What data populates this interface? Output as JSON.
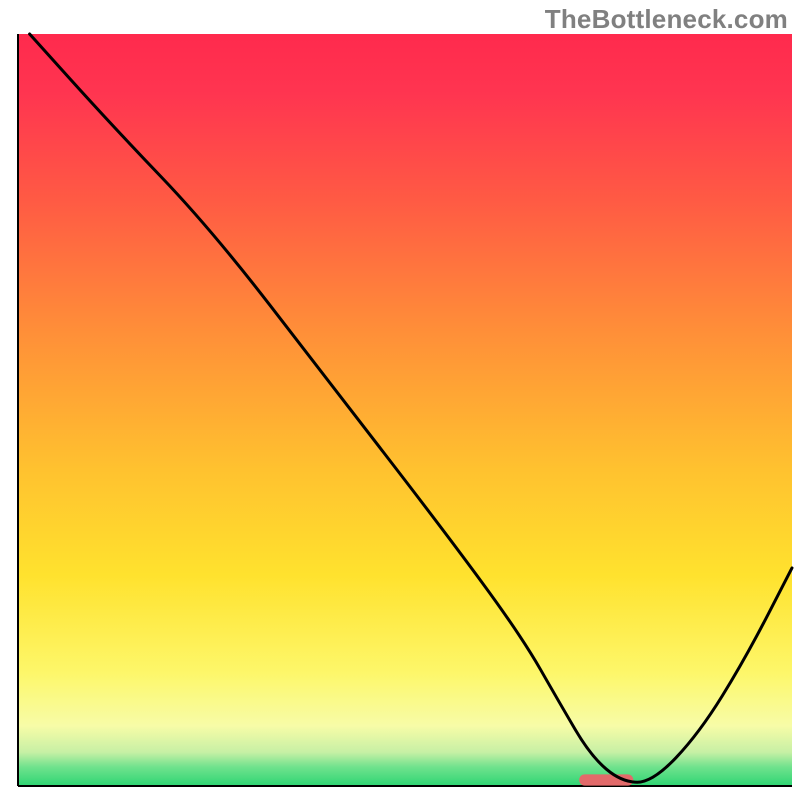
{
  "watermark": "TheBottleneck.com",
  "chart_data": {
    "type": "line",
    "title": "",
    "xlabel": "",
    "ylabel": "",
    "xlim": [
      0,
      100
    ],
    "ylim": [
      0,
      100
    ],
    "axes_visible": false,
    "grid": false,
    "legend": false,
    "background_gradient": {
      "stops": [
        {
          "offset": 0.0,
          "color": "#ff2a4d"
        },
        {
          "offset": 0.08,
          "color": "#ff3550"
        },
        {
          "offset": 0.22,
          "color": "#ff5a44"
        },
        {
          "offset": 0.4,
          "color": "#ff9038"
        },
        {
          "offset": 0.58,
          "color": "#ffc22f"
        },
        {
          "offset": 0.72,
          "color": "#ffe22e"
        },
        {
          "offset": 0.85,
          "color": "#fdf76a"
        },
        {
          "offset": 0.92,
          "color": "#f7fca7"
        },
        {
          "offset": 0.955,
          "color": "#c7f0a5"
        },
        {
          "offset": 0.975,
          "color": "#6fe28d"
        },
        {
          "offset": 1.0,
          "color": "#2ed573"
        }
      ]
    },
    "series": [
      {
        "name": "bottleneck-curve",
        "stroke": "#000000",
        "stroke_width": 3,
        "x": [
          1.5,
          12,
          25,
          40,
          55,
          65,
          70,
          74,
          78,
          82,
          88,
          94,
          100
        ],
        "y": [
          100,
          88,
          74,
          54,
          34,
          20,
          11,
          4,
          0.5,
          0.5,
          7,
          17,
          29
        ]
      }
    ],
    "markers": [
      {
        "name": "optimal-range-marker",
        "shape": "capsule",
        "fill": "#e26a6a",
        "x_center": 76,
        "y_center": 0.8,
        "width_x_units": 7,
        "height_y_units": 1.5
      }
    ],
    "frame": {
      "left": true,
      "bottom": true,
      "right": false,
      "top": false,
      "color": "#000000",
      "width": 2
    }
  }
}
